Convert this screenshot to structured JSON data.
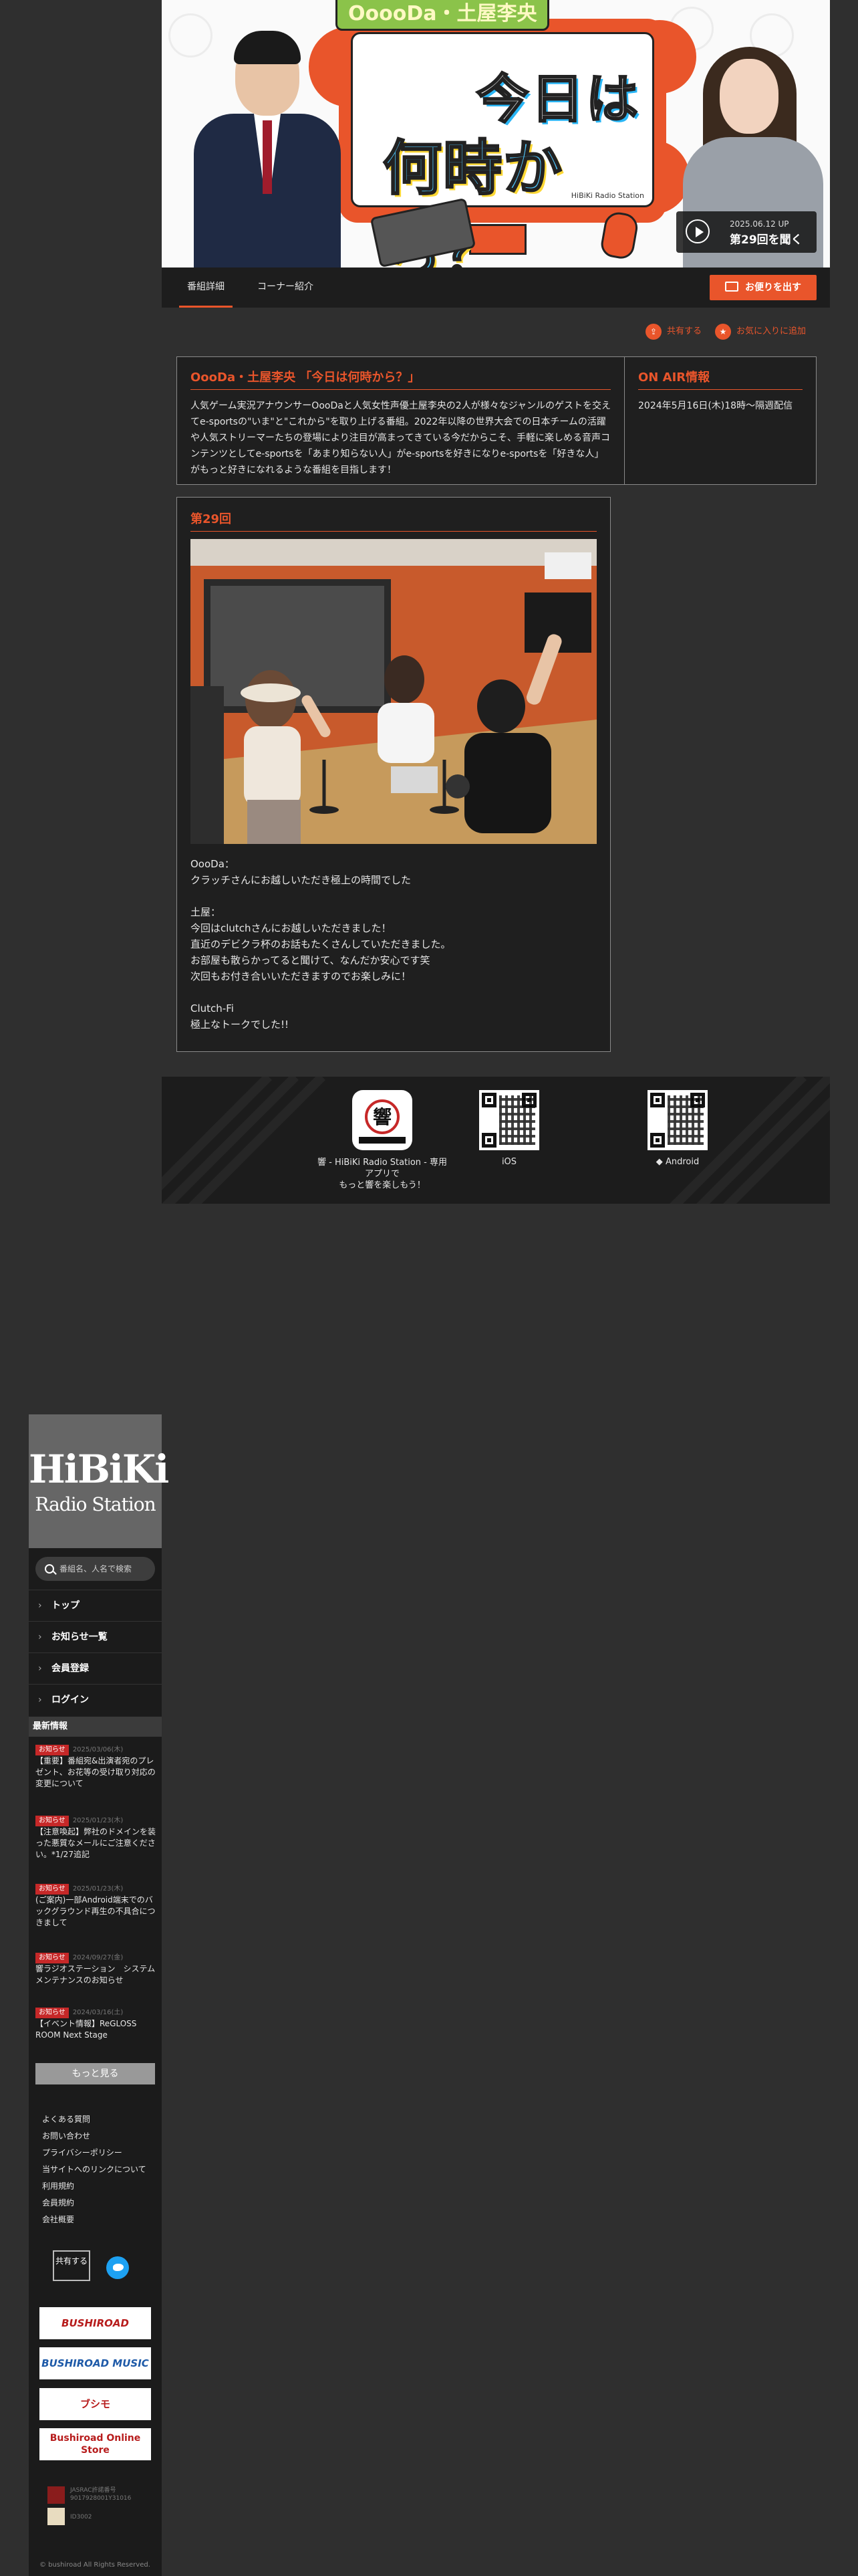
{
  "hero": {
    "show_logo": "OoooDa・土屋李央",
    "title_line1": "今日は",
    "title_line2": "何時から？",
    "credit": "HiBiKi Radio Station",
    "up_date": "2025.06.12 UP",
    "listen_label": "第29回を聞く"
  },
  "tabs": {
    "detail": "番組詳細",
    "corner": "コーナー紹介",
    "mail_button": "お便りを出す"
  },
  "actions": {
    "share": "共有する",
    "favorite": "お気に入りに追加"
  },
  "program": {
    "title": "OooDa・土屋李央 「今日は何時から？」",
    "description": "人気ゲーム実況アナウンサーOooDaと人気女性声優土屋李央の2人が様々なジャンルのゲストを交えてe-sportsの\"いま\"と\"これから\"を取り上げる番組。2022年以降の世界大会での日本チームの活躍や人気ストリーマーたちの登場により注目が高まってきている今だからこそ、手軽に楽しめる音声コンテンツとしてe-sportsを「あまり知らない人」がe-sportsを好きになりe-sportsを「好きな人」がもっと好きになれるような番組を目指します！",
    "on_air_title": "ON AIR情報",
    "on_air_text": "2024年5月16日(木)18時〜隔週配信"
  },
  "episode": {
    "title": "第29回",
    "comment": "OooDa：\nクラッチさんにお越しいただき極上の時間でした\n\n土屋：\n今回はclutchさんにお越しいただきました！\n直近のデビクラ杯のお話もたくさんしていただきました。\nお部屋も散らかってると聞けて、なんだか安心です笑\n次回もお付き合いいただきますのでお楽しみに！\n\nClutch-Fi\n極上なトークでした!!"
  },
  "apps": {
    "app_caption": "響 - HiBiKi Radio Station - 専用アプリで\nもっと響を楽しもう！",
    "ios": "iOS",
    "android": "Android"
  },
  "sidebar": {
    "logo_line1": "HiBiKi",
    "logo_line2": "Radio Station",
    "search_placeholder": "番組名、人名で検索",
    "nav": [
      "トップ",
      "お知らせ一覧",
      "会員登録",
      "ログイン"
    ],
    "news_heading": "最新情報",
    "news": [
      {
        "badge": "お知らせ",
        "date": "2025/03/06(木)",
        "title": "【重要】番組宛&出演者宛のプレゼント、お花等の受け取り対応の変更について"
      },
      {
        "badge": "お知らせ",
        "date": "2025/01/23(木)",
        "title": "【注意喚起】弊社のドメインを装った悪質なメールにご注意ください。*1/27追記"
      },
      {
        "badge": "お知らせ",
        "date": "2025/01/23(木)",
        "title": "(ご案内)一部Android端末でのバックグラウンド再生の不具合につきまして"
      },
      {
        "badge": "お知らせ",
        "date": "2024/09/27(金)",
        "title": "響ラジオステーション　システムメンテナンスのお知らせ"
      },
      {
        "badge": "お知らせ",
        "date": "2024/03/16(土)",
        "title": "【イベント情報】ReGLOSS ROOM Next Stage"
      }
    ],
    "more_label": "もっと見る",
    "links": [
      "よくある質問",
      "お問い合わせ",
      "プライバシーポリシー",
      "当サイトへのリンクについて",
      "利用規約",
      "会員規約",
      "会社概要"
    ],
    "share_label": "共有する",
    "banners": [
      "BUSHIROAD",
      "BUSHIROAD MUSIC",
      "ブシモ",
      "Bushiroad Online Store"
    ],
    "jasrac": "JASRAC許諾番号 9017928001Y31016",
    "jasrac2": "ID3002",
    "copyright": "© bushiroad All Rights Reserved."
  }
}
